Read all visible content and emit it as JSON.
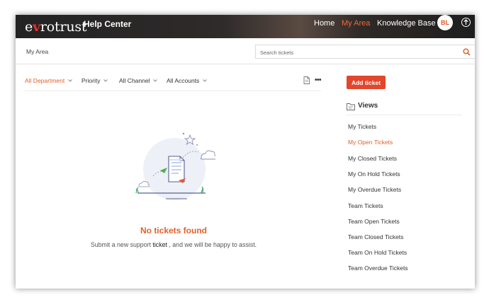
{
  "header": {
    "logo_prefix": "e",
    "logo_v": "v",
    "logo_suffix": "rotrust",
    "help_center": "Help Center",
    "nav": {
      "home": "Home",
      "my_area": "My Area",
      "knowledge_base": "Knowledge Base"
    },
    "avatar_initials": "BL",
    "active_color": "#f0683a"
  },
  "subbar": {
    "breadcrumb": "My Area",
    "search_placeholder": "Search tickets"
  },
  "filters": {
    "department": "All Department",
    "priority": "Priority",
    "channel": "All Channel",
    "accounts": "All Accounts"
  },
  "empty_state": {
    "title": "No tickets found",
    "text_before": "Submit a new support ",
    "text_emphasis": "ticket",
    "text_after": " , and we will be happy to assist."
  },
  "sidebar": {
    "add_ticket": "Add ticket",
    "views_title": "Views",
    "views": [
      {
        "label": "My Tickets",
        "active": false
      },
      {
        "label": "My Open Tickets",
        "active": true
      },
      {
        "label": "My Closed Tickets",
        "active": false
      },
      {
        "label": "My On Hold Tickets",
        "active": false
      },
      {
        "label": "My Overdue Tickets",
        "active": false
      },
      {
        "label": "Team Tickets",
        "active": false
      },
      {
        "label": "Team Open Tickets",
        "active": false
      },
      {
        "label": "Team Closed Tickets",
        "active": false
      },
      {
        "label": "Team On Hold Tickets",
        "active": false
      },
      {
        "label": "Team Overdue Tickets",
        "active": false
      }
    ]
  },
  "colors": {
    "accent": "#e2612b",
    "button": "#e2462b"
  }
}
